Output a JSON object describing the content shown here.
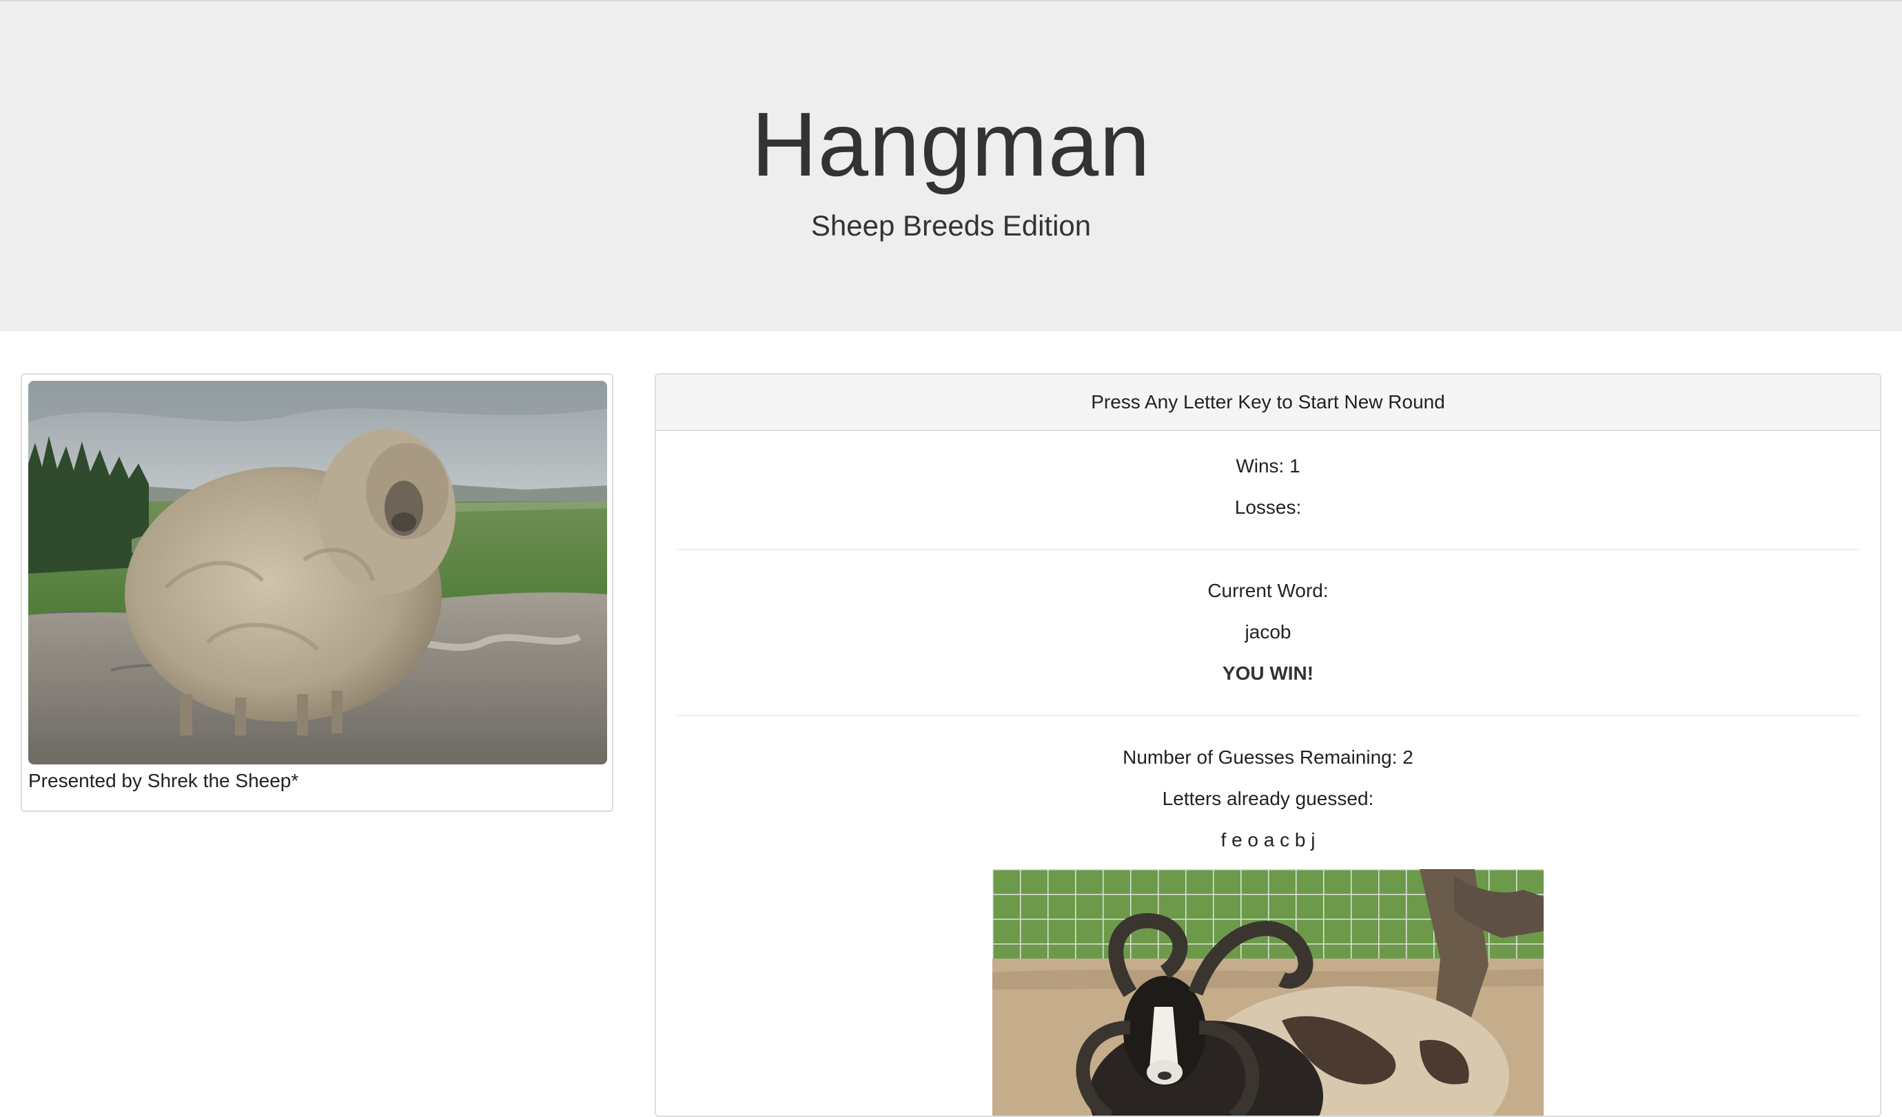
{
  "header": {
    "title": "Hangman",
    "subtitle": "Sheep Breeds Edition"
  },
  "sidebar": {
    "caption": "Presented by Shrek the Sheep*",
    "image_alt": "Shrek the Sheep"
  },
  "game": {
    "heading": "Press Any Letter Key to Start New Round",
    "wins_label": "Wins: 1",
    "losses_label": "Losses:",
    "current_word_label": "Current Word:",
    "current_word": "jacob",
    "result": "YOU WIN!",
    "guesses_remaining_label": "Number of Guesses Remaining: 2",
    "letters_guessed_label": "Letters already guessed:",
    "letters_guessed": "f e o a c b j",
    "image_alt": "Jacob sheep"
  }
}
